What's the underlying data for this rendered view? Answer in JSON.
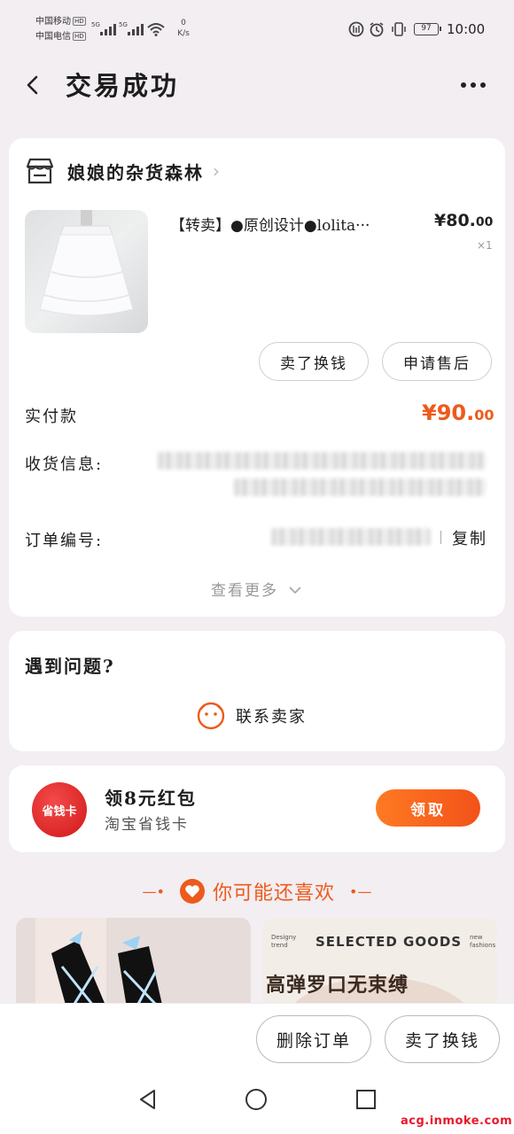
{
  "status_bar": {
    "carrier1": "中国移动",
    "carrier2": "中国电信",
    "hd": "HD",
    "net_5g": "5G",
    "net_speed_value": "0",
    "net_speed_unit": "K/s",
    "battery": "97",
    "time": "10:00"
  },
  "header": {
    "title": "交易成功"
  },
  "shop": {
    "name": "娘娘的杂货森林"
  },
  "product": {
    "title": "【转卖】●原创设计●lolita···",
    "price_int": "¥80.",
    "price_dec": "00",
    "quantity": "×1"
  },
  "actions": {
    "sell_for_cash": "卖了换钱",
    "after_sales": "申请售后"
  },
  "order": {
    "paid_label": "实付款",
    "paid_int": "¥90.",
    "paid_dec": "00",
    "shipping_label": "收货信息:",
    "order_no_label": "订单编号:",
    "copy": "复制",
    "view_more": "查看更多"
  },
  "help": {
    "title": "遇到问题?",
    "contact": "联系卖家"
  },
  "coupon": {
    "logo": "省钱卡",
    "title": "领8元红包",
    "subtitle": "淘宝省钱卡",
    "button": "领取"
  },
  "recommend": {
    "heading": "你可能还喜欢",
    "item2_top": "SELECTED GOODS",
    "item2_tag_left": "Designy trend",
    "item2_tag_right": "new fashions",
    "item2_main": "高弹罗口无束缚"
  },
  "bottom": {
    "delete_order": "删除订单",
    "sell_for_cash": "卖了换钱"
  },
  "watermark": "acg.inmoke.com",
  "colors": {
    "accent": "#ee5a1c",
    "brand_red": "#d31818"
  }
}
